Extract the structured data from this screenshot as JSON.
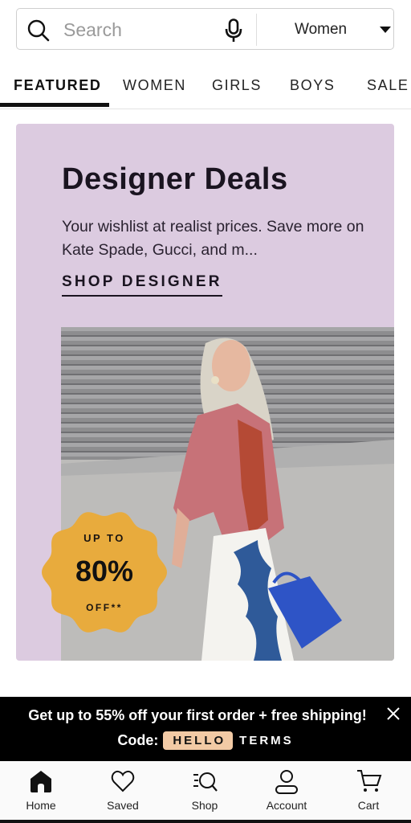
{
  "search": {
    "placeholder": "Search",
    "department": "Women"
  },
  "tabs": [
    {
      "label": "FEATURED",
      "active": true
    },
    {
      "label": "WOMEN",
      "active": false
    },
    {
      "label": "GIRLS",
      "active": false
    },
    {
      "label": "BOYS",
      "active": false
    },
    {
      "label": "SALE",
      "active": false
    }
  ],
  "promo": {
    "title": "Designer Deals",
    "description": "Your wishlist at realist prices. Save more on Kate Spade, Gucci, and m...",
    "link_label": "SHOP DESIGNER",
    "background_color": "#dccbe0",
    "badge": {
      "top": "UP TO",
      "main": "80%",
      "bottom": "OFF**",
      "color": "#e8ab3d"
    }
  },
  "offer_banner": {
    "text": "Get up to 55% off your first order + free shipping!",
    "code_label": "Code:",
    "code": "HELLO",
    "terms_label": "TERMS",
    "code_chip_color": "#f2caa5"
  },
  "bottom_nav": [
    {
      "label": "Home",
      "icon": "home-icon",
      "active": true
    },
    {
      "label": "Saved",
      "icon": "heart-icon",
      "active": false
    },
    {
      "label": "Shop",
      "icon": "shop-search-icon",
      "active": false
    },
    {
      "label": "Account",
      "icon": "account-icon",
      "active": false
    },
    {
      "label": "Cart",
      "icon": "cart-icon",
      "active": false
    }
  ]
}
